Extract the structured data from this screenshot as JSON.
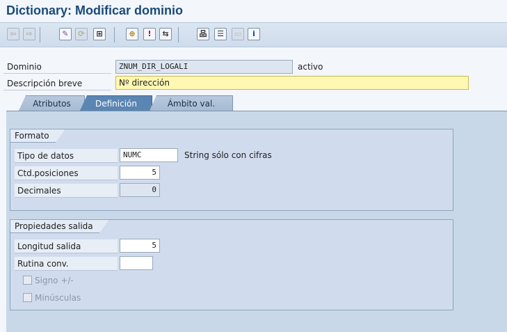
{
  "window": {
    "title": "Dictionary: Modificar dominio"
  },
  "toolbar": {
    "buttons": [
      {
        "name": "back-icon",
        "glyph": "⇦",
        "color": "#8a8a8a",
        "disabled": true
      },
      {
        "name": "forward-icon",
        "glyph": "⇨",
        "color": "#8a8a8a",
        "disabled": true
      },
      {
        "name": "display-change-icon",
        "glyph": "✎",
        "color": "#7a4aa0"
      },
      {
        "name": "other-object-icon",
        "glyph": "⟳",
        "color": "#7a9a3a",
        "disabled": true
      },
      {
        "name": "check-icon",
        "glyph": "⊞",
        "color": "#222"
      },
      {
        "name": "activate-icon",
        "glyph": "⊕",
        "color": "#b5851c"
      },
      {
        "name": "where-used-icon",
        "glyph": "!",
        "color": "#c00"
      },
      {
        "name": "navigate-icon",
        "glyph": "⇆",
        "color": "#333"
      },
      {
        "name": "hierarchy-icon",
        "glyph": "品",
        "color": "#333"
      },
      {
        "name": "print-icon",
        "glyph": "☰",
        "color": "#333"
      },
      {
        "name": "layout-icon",
        "glyph": "▭",
        "color": "#999",
        "disabled": true
      },
      {
        "name": "info-icon",
        "glyph": "i",
        "color": "#1a3a9a"
      }
    ]
  },
  "header": {
    "domain_label": "Dominio",
    "domain_value": "ZNUM_DIR_LOGALI",
    "domain_status": "activo",
    "desc_label": "Descripción breve",
    "desc_value": "Nº dirección"
  },
  "tabs": [
    {
      "label": "Atributos",
      "active": false
    },
    {
      "label": "Definición",
      "active": true
    },
    {
      "label": "Ámbito val.",
      "active": false
    }
  ],
  "formato": {
    "title": "Formato",
    "tipo_label": "Tipo de datos",
    "tipo_value": "NUMC",
    "tipo_desc": "String sólo con cifras",
    "posiciones_label": "Ctd.posiciones",
    "posiciones_value": "5",
    "decimales_label": "Decimales",
    "decimales_value": "0"
  },
  "salida": {
    "title": "Propiedades salida",
    "longitud_label": "Longitud salida",
    "longitud_value": "5",
    "rutina_label": "Rutina conv.",
    "rutina_value": "",
    "signo_label": "Signo +/-",
    "signo_checked": false,
    "minusculas_label": "Minúsculas",
    "minusculas_checked": false
  }
}
